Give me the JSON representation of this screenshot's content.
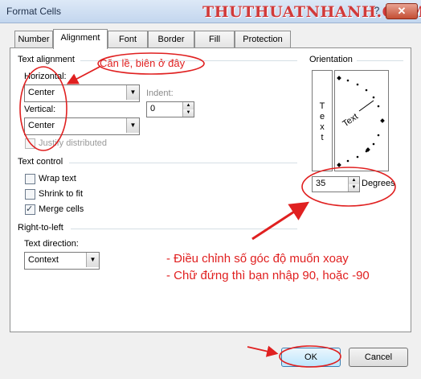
{
  "window": {
    "title": "Format Cells",
    "watermark": "THUTHUATNHANH.COM",
    "close_glyph": "✕",
    "help_glyph": "?"
  },
  "tabs": [
    {
      "label": "Number"
    },
    {
      "label": "Alignment"
    },
    {
      "label": "Font"
    },
    {
      "label": "Border"
    },
    {
      "label": "Fill"
    },
    {
      "label": "Protection"
    }
  ],
  "text_alignment": {
    "heading": "Text alignment",
    "horizontal_label": "Horizontal:",
    "horizontal_value": "Center",
    "vertical_label": "Vertical:",
    "vertical_value": "Center",
    "indent_label": "Indent:",
    "indent_value": "0",
    "justify_distributed": "Justify distributed"
  },
  "text_control": {
    "heading": "Text control",
    "wrap_text": {
      "label": "Wrap text",
      "checked": false
    },
    "shrink_to_fit": {
      "label": "Shrink to fit",
      "checked": false
    },
    "merge_cells": {
      "label": "Merge cells",
      "checked": true
    }
  },
  "right_to_left": {
    "heading": "Right-to-left",
    "direction_label": "Text direction:",
    "direction_value": "Context"
  },
  "orientation": {
    "heading": "Orientation",
    "vertical_text": [
      "T",
      "e",
      "x",
      "t"
    ],
    "dial_text": "Text",
    "degrees_value": "35",
    "degrees_label": "Degrees"
  },
  "buttons": {
    "ok": "OK",
    "cancel": "Cancel"
  },
  "annotations": {
    "callout_1": "Căn lề, biên ở đây",
    "note_line_1": "- Điều chỉnh số góc độ muốn xoay",
    "note_line_2": "- Chữ đứng thì bạn nhập 90, hoặc -90",
    "color": "#e02020"
  }
}
